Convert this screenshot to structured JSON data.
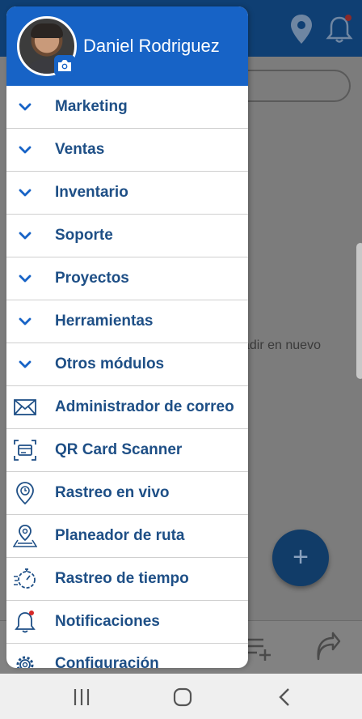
{
  "user": {
    "name": "Daniel Rodriguez"
  },
  "menu": [
    {
      "label": "Marketing",
      "icon": "chevron-down-icon"
    },
    {
      "label": "Ventas",
      "icon": "chevron-down-icon"
    },
    {
      "label": "Inventario",
      "icon": "chevron-down-icon"
    },
    {
      "label": "Soporte",
      "icon": "chevron-down-icon"
    },
    {
      "label": "Proyectos",
      "icon": "chevron-down-icon"
    },
    {
      "label": "Herramientas",
      "icon": "chevron-down-icon"
    },
    {
      "label": "Otros módulos",
      "icon": "chevron-down-icon"
    },
    {
      "label": "Administrador de correo",
      "icon": "envelope-icon"
    },
    {
      "label": "QR Card Scanner",
      "icon": "card-scanner-icon"
    },
    {
      "label": "Rastreo en vivo",
      "icon": "location-clock-icon"
    },
    {
      "label": "Planeador de ruta",
      "icon": "route-map-icon"
    },
    {
      "label": "Rastreo de tiempo",
      "icon": "stopwatch-icon"
    },
    {
      "label": "Notificaciones",
      "icon": "bell-icon"
    },
    {
      "label": "Configuración",
      "icon": "gear-icon"
    }
  ],
  "background": {
    "partial_text": "adir en nuevo",
    "fab_label": "+"
  },
  "colors": {
    "drawer_header": "#1763c6",
    "menu_text": "#1e4f86",
    "app_header": "#0f3f73"
  }
}
